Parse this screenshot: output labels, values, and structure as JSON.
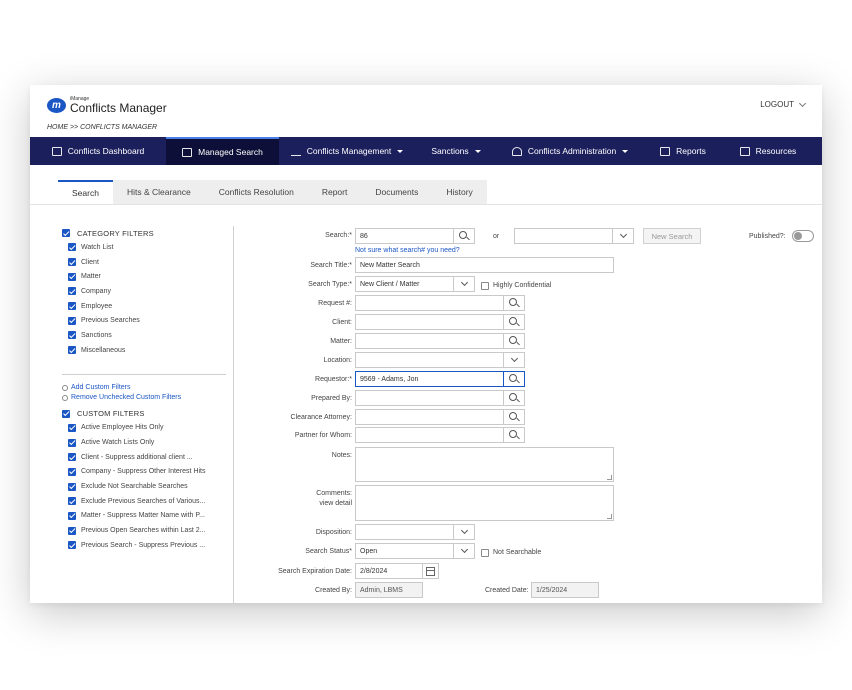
{
  "brand": {
    "small": "iManage",
    "big": "Conflicts Manager",
    "mark": "m"
  },
  "header": {
    "logout": "LOGOUT",
    "breadcrumb": "HOME >> CONFLICTS MANAGER"
  },
  "nav": [
    {
      "label": "Conflicts Dashboard",
      "icon": "list-icon"
    },
    {
      "label": "Managed Search",
      "icon": "search-doc-icon",
      "active": true
    },
    {
      "label": "Conflicts Management",
      "icon": "scales-icon",
      "caret": true
    },
    {
      "label": "Sanctions",
      "caret": true
    },
    {
      "label": "Conflicts Administration",
      "icon": "user-icon",
      "caret": true
    },
    {
      "label": "Reports",
      "icon": "report-icon"
    },
    {
      "label": "Resources",
      "icon": "resources-icon"
    }
  ],
  "tabs": [
    "Search",
    "Hits & Clearance",
    "Conflicts Resolution",
    "Report",
    "Documents",
    "History"
  ],
  "category_filters": {
    "title": "CATEGORY FILTERS",
    "items": [
      "Watch List",
      "Client",
      "Matter",
      "Company",
      "Employee",
      "Previous Searches",
      "Sanctions",
      "Miscellaneous"
    ]
  },
  "custom_links": {
    "add": "Add Custom Filters",
    "remove": "Remove Unchecked Custom Filters"
  },
  "custom_filters": {
    "title": "CUSTOM FILTERS",
    "items": [
      "Active Employee Hits Only",
      "Active Watch Lists Only",
      "Client - Suppress additional client ...",
      "Company - Suppress Other Interest Hits",
      "Exclude Not Searchable Searches",
      "Exclude Previous Searches of Various...",
      "Matter - Suppress Matter Name with P...",
      "Previous Open Searches within Last 2...",
      "Previous Search - Suppress Previous ..."
    ]
  },
  "form": {
    "search_label": "Search:*",
    "search_value": "86",
    "or": "or",
    "new_search": "New Search",
    "published_label": "Published?:",
    "help_link": "Not sure what search# you need?",
    "title_label": "Search Title:*",
    "title_value": "New Matter Search",
    "type_label": "Search Type:*",
    "type_value": "New Client / Matter",
    "highly_conf": "Highly Confidential",
    "request_label": "Request #:",
    "client_label": "Client:",
    "matter_label": "Matter:",
    "location_label": "Location:",
    "requestor_label": "Requestor:*",
    "requestor_value": "9569 - Adams, Jon",
    "prepared_label": "Prepared By:",
    "clearance_label": "Clearance Attorney:",
    "partner_label": "Partner for Whom:",
    "notes_label": "Notes:",
    "comments_label": "Comments:",
    "view_detail": "view detail",
    "disposition_label": "Disposition:",
    "status_label": "Search Status*",
    "status_value": "Open",
    "not_searchable": "Not Searchable",
    "expiration_label": "Search Expiration Date:",
    "expiration_value": "2/8/2024",
    "created_by_label": "Created By:",
    "created_by_value": "Admin, LBMS",
    "created_date_label": "Created Date:",
    "created_date_value": "1/25/2024"
  },
  "colors": {
    "nav": "#1b1f5c",
    "nav_active": "#0d0f38",
    "accent": "#1a56c4"
  }
}
